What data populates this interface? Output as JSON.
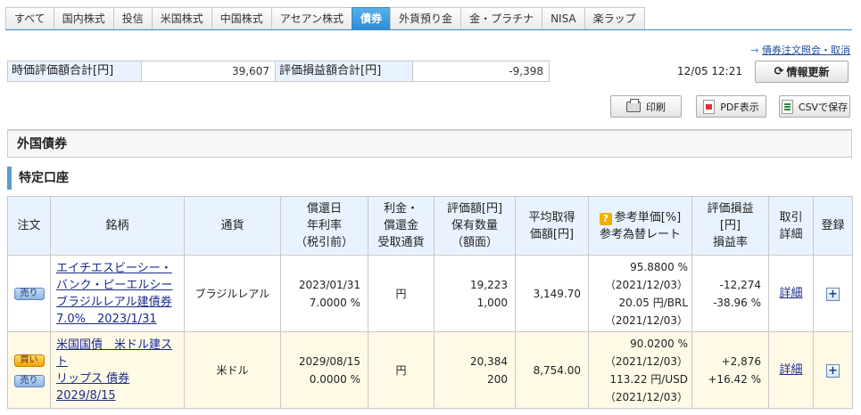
{
  "tabs": [
    {
      "label": "すべて",
      "active": false
    },
    {
      "label": "国内株式",
      "active": false
    },
    {
      "label": "投信",
      "active": false
    },
    {
      "label": "米国株式",
      "active": false
    },
    {
      "label": "中国株式",
      "active": false
    },
    {
      "label": "アセアン株式",
      "active": false
    },
    {
      "label": "債券",
      "active": true
    },
    {
      "label": "外貨預り金",
      "active": false
    },
    {
      "label": "金・プラチナ",
      "active": false
    },
    {
      "label": "NISA",
      "active": false
    },
    {
      "label": "楽ラップ",
      "active": false
    }
  ],
  "order_inquiry_link": "債券注文照会・取消",
  "summary": {
    "valuation_label": "時価評価額合計[円]",
    "valuation_value": "39,607",
    "pl_label": "評価損益額合計[円]",
    "pl_value": "-9,398"
  },
  "timestamp": "12/05 12:21",
  "buttons": {
    "refresh": "情報更新",
    "print": "印刷",
    "pdf": "PDF表示",
    "csv": "CSVで保存"
  },
  "section_title": "外国債券",
  "account_title": "特定口座",
  "table": {
    "headers": {
      "order": "注文",
      "name": "銘柄",
      "currency": "通貨",
      "redemption_l1": "償還日",
      "redemption_l2": "年利率",
      "redemption_l3": "（税引前）",
      "interest_l1": "利金・",
      "interest_l2": "償還金",
      "interest_l3": "受取通貨",
      "valuation_l1": "評価額[円]",
      "valuation_l2": "保有数量",
      "valuation_l3": "（額面）",
      "avgcost_l1": "平均取得",
      "avgcost_l2": "価額[円]",
      "refprice_l1": "参考単価[%]",
      "refprice_l2": "参考為替レート",
      "pl_l1": "評価損益",
      "pl_l2": "[円]",
      "pl_l3": "損益率",
      "trade_l1": "取引",
      "trade_l2": "詳細",
      "register": "登録"
    },
    "rows": [
      {
        "buy_label": "",
        "sell_label": "売り",
        "name_lines": [
          "エイチエスビーシー・",
          "バンク・ピーエルシー",
          "ブラジルレアル建債券",
          "7.0%　2023/1/31"
        ],
        "currency": "ブラジルレアル",
        "redemption_date": "2023/01/31",
        "rate": "7.0000 %",
        "receipt_currency": "円",
        "valuation": "19,223",
        "quantity": "1,000",
        "avg_cost": "3,149.70",
        "ref_price": "95.8800 %",
        "ref_price_date": "（2021/12/03）",
        "ref_fx": "20.05 円/BRL",
        "ref_fx_date": "（2021/12/03）",
        "pl": "-12,274",
        "pl_rate": "-38.96 %",
        "pl_sign": "neg",
        "detail": "詳細",
        "plus": "+"
      },
      {
        "buy_label": "買い",
        "sell_label": "売り",
        "name_lines": [
          "米国国債　米ドル建スト",
          "リップス 債券",
          "2029/8/15"
        ],
        "currency": "米ドル",
        "redemption_date": "2029/08/15",
        "rate": "0.0000 %",
        "receipt_currency": "円",
        "valuation": "20,384",
        "quantity": "200",
        "avg_cost": "8,754.00",
        "ref_price": "90.0200 %",
        "ref_price_date": "（2021/12/03）",
        "ref_fx": "113.22 円/USD",
        "ref_fx_date": "（2021/12/03）",
        "pl": "+2,876",
        "pl_rate": "+16.42 %",
        "pl_sign": "pos",
        "detail": "詳細",
        "plus": "+"
      }
    ]
  }
}
